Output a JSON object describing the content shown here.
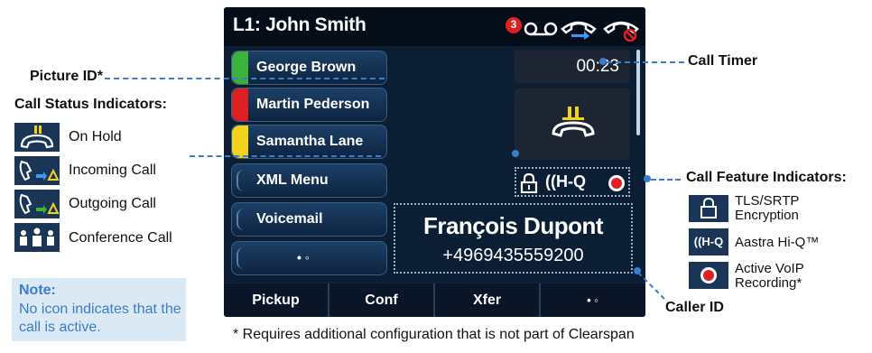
{
  "screen": {
    "line_title": "L1: John Smith",
    "status_icons": [
      "missed-calls-badge-icon",
      "voicemail-icon",
      "call-forward-icon",
      "do-not-disturb-icon"
    ],
    "missed_count": "3",
    "line_keys": [
      {
        "label": "George Brown",
        "status_color": "#3bb33b"
      },
      {
        "label": "Martin Pederson",
        "status_color": "#e02020"
      },
      {
        "label": "Samantha Lane",
        "status_color": "#f2d21a"
      },
      {
        "label": "XML Menu",
        "status_color": ""
      },
      {
        "label": "Voicemail",
        "status_color": ""
      },
      {
        "label": "• ◦",
        "status_color": ""
      }
    ],
    "call_timer": "00:23",
    "hold_icon": "on-hold-handset-icon",
    "feature_icons": [
      "lock-icon",
      "hiq-icon",
      "record-icon"
    ],
    "hiq_label": "((H-Q",
    "caller_name": "François Dupont",
    "caller_number": "+4969435559200",
    "softkeys": [
      "Pickup",
      "Conf",
      "Xfer",
      "• ◦"
    ]
  },
  "annotations": {
    "picture_id": "Picture ID*",
    "call_status_title": "Call Status Indicators:",
    "status_items": [
      {
        "label": "On Hold",
        "icon": "on-hold-icon"
      },
      {
        "label": "Incoming Call",
        "icon": "incoming-call-icon"
      },
      {
        "label": "Outgoing Call",
        "icon": "outgoing-call-icon"
      },
      {
        "label": "Conference Call",
        "icon": "conference-call-icon"
      }
    ],
    "note_title": "Note:",
    "note_body": "No icon indicates that the call is active.",
    "call_timer": "Call Timer",
    "call_feature_title": "Call Feature Indicators:",
    "feature_items": [
      {
        "label": "TLS/SRTP Encryption",
        "icon": "lock-icon"
      },
      {
        "label": "Aastra Hi-Q™",
        "icon": "hiq-icon"
      },
      {
        "label": "Active VoIP Recording*",
        "icon": "record-icon"
      }
    ],
    "caller_id": "Caller ID",
    "footnote": "* Requires additional configuration that is not part of Clearspan"
  },
  "colors": {
    "screen_bg": "#0b1e33",
    "accent": "#3a7dc9",
    "hold_yellow": "#f2d21a",
    "record_red": "#e02020"
  }
}
